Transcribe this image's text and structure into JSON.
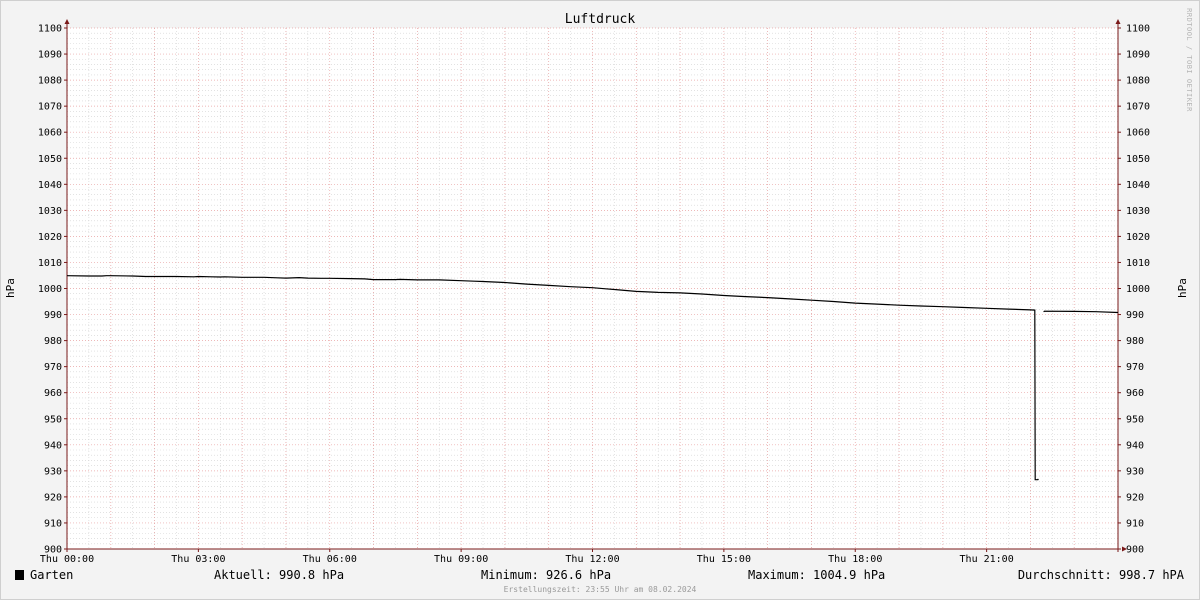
{
  "chart_data": {
    "type": "line",
    "title": "Luftdruck",
    "ylabel": "hPa",
    "ylim": [
      900,
      1100
    ],
    "yticks": [
      900,
      910,
      920,
      930,
      940,
      950,
      960,
      970,
      980,
      990,
      1000,
      1010,
      1020,
      1030,
      1040,
      1050,
      1060,
      1070,
      1080,
      1090,
      1100
    ],
    "xlim": [
      0,
      24
    ],
    "xtick_positions": [
      0,
      3,
      6,
      9,
      12,
      15,
      18,
      21
    ],
    "xtick_labels": [
      "Thu 00:00",
      "Thu 03:00",
      "Thu 06:00",
      "Thu 09:00",
      "Thu 12:00",
      "Thu 15:00",
      "Thu 18:00",
      "Thu 21:00"
    ],
    "grid": true,
    "series": [
      {
        "name": "Garten",
        "color": "#000000",
        "x": [
          0,
          0.5,
          0.8,
          0.9,
          1.0,
          1.5,
          1.8,
          2.0,
          2.5,
          2.9,
          3.0,
          3.3,
          3.5,
          3.6,
          4.0,
          4.5,
          4.8,
          5.0,
          5.3,
          5.5,
          5.8,
          6.0,
          6.5,
          6.8,
          7.0,
          7.5,
          7.6,
          8.0,
          8.5,
          9.0,
          9.3,
          9.5,
          10.0,
          10.5,
          11.0,
          11.5,
          12.0,
          12.3,
          12.5,
          13.0,
          13.5,
          14.0,
          14.5,
          15.0,
          15.5,
          16.0,
          16.5,
          17.0,
          17.5,
          18.0,
          18.5,
          19.0,
          19.5,
          20.0,
          20.5,
          21.0,
          21.5,
          22.0,
          22.1,
          22.11,
          22.17,
          22.18,
          22.3,
          22.32,
          23.0,
          23.5,
          24.0
        ],
        "y": [
          1004.9,
          1004.8,
          1004.8,
          1004.9,
          1004.9,
          1004.8,
          1004.6,
          1004.6,
          1004.6,
          1004.5,
          1004.6,
          1004.5,
          1004.4,
          1004.5,
          1004.3,
          1004.3,
          1004.1,
          1004.0,
          1004.2,
          1004.0,
          1003.9,
          1003.9,
          1003.8,
          1003.7,
          1003.4,
          1003.4,
          1003.5,
          1003.3,
          1003.3,
          1003.0,
          1002.8,
          1002.7,
          1002.3,
          1001.7,
          1001.2,
          1000.7,
          1000.3,
          999.9,
          999.6,
          998.9,
          998.5,
          998.3,
          997.9,
          997.3,
          996.9,
          996.5,
          996.0,
          995.5,
          995.0,
          994.4,
          994.0,
          993.6,
          993.3,
          993.0,
          992.7,
          992.4,
          992.1,
          991.8,
          991.7,
          926.6,
          926.6,
          926.9,
          991.1,
          991.3,
          991.2,
          991.1,
          990.8
        ]
      }
    ],
    "legend": "bottom-left"
  },
  "watermark": "RRDTOOL / TOBI OETIKER",
  "legend_row": {
    "series_name": "Garten",
    "series_color": "#000000",
    "aktuell": "Aktuell: 990.8 hPa",
    "minimum": "Minimum: 926.6 hPa",
    "maximum": "Maximum: 1004.9 hPa",
    "durchschnitt": "Durchschnitt: 998.7 hPA"
  },
  "footer": "Erstellungszeit: 23:55 Uhr am 08.02.2024",
  "colors": {
    "background": "#f3f3f3",
    "plot_background": "#ffffff",
    "minor_grid": "#d2d2d2",
    "major_grid": "#e8a0a0",
    "axis": "#7a1a1a",
    "line": "#000000"
  }
}
